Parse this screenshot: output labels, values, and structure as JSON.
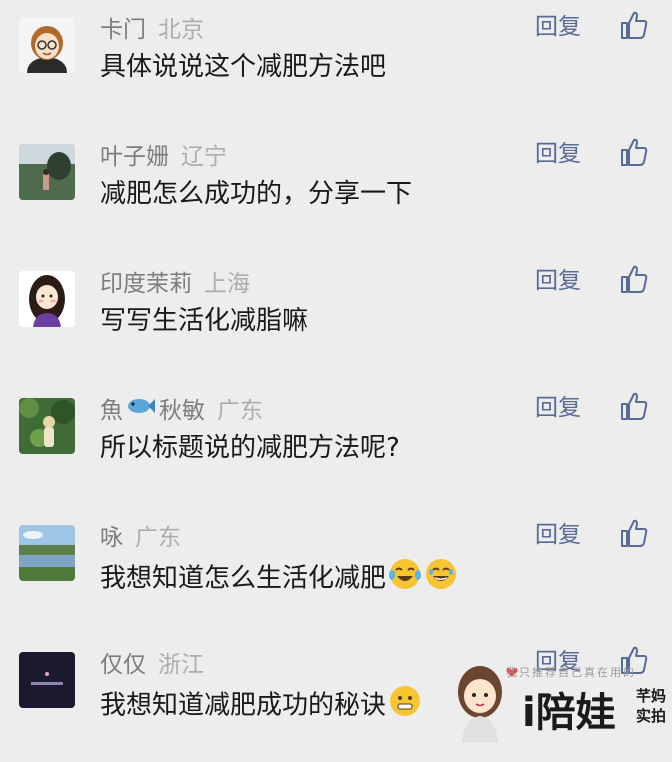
{
  "comments": [
    {
      "nickname": "卡门",
      "region": "北京",
      "text": "具体说说这个减肥方法吧",
      "reply_label": "回复",
      "avatar": "cartoon-woman-glasses"
    },
    {
      "nickname": "叶子姗",
      "region": "辽宁",
      "text": "减肥怎么成功的，分享一下",
      "reply_label": "回复",
      "avatar": "park-photo"
    },
    {
      "nickname": "印度茉莉",
      "region": "上海",
      "text": "写写生活化减脂嘛",
      "reply_label": "回复",
      "avatar": "cartoon-girl"
    },
    {
      "nickname_prefix": "魚",
      "nickname_suffix": "秋敏",
      "region": "广东",
      "text": "所以标题说的减肥方法呢?",
      "reply_label": "回复",
      "avatar": "garden-photo",
      "nickname_emoji": "fish-emoji"
    },
    {
      "nickname": "咏",
      "region": "广东",
      "text": "我想知道怎么生活化减肥",
      "reply_label": "回复",
      "avatar": "lake-photo",
      "trailing_emoji": [
        "crying-laughing-emoji",
        "laughing-emoji"
      ]
    },
    {
      "nickname": "仅仅",
      "region": "浙江",
      "text": "我想知道减肥成功的秘诀",
      "reply_label": "回复",
      "avatar": "dark-text-logo",
      "trailing_emoji": [
        "grimace-emoji"
      ]
    }
  ],
  "watermark": {
    "tagline": "我只推荐自己真在用的",
    "logo": "i陪娃",
    "side_line1": "芊妈",
    "side_line2": "实拍"
  },
  "colors": {
    "background": "#ededed",
    "nickname": "#7d7d7d",
    "region": "#adadad",
    "text": "#191919",
    "reply": "#576b95"
  }
}
